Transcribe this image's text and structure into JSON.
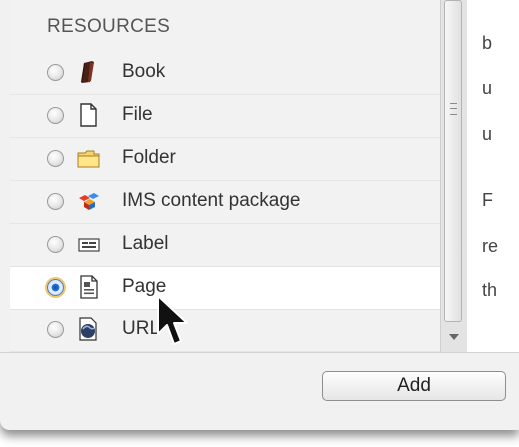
{
  "resources": {
    "heading": "RESOURCES",
    "items": [
      {
        "label": "Book",
        "icon": "book-icon",
        "selected": false
      },
      {
        "label": "File",
        "icon": "file-icon",
        "selected": false
      },
      {
        "label": "Folder",
        "icon": "folder-icon",
        "selected": false
      },
      {
        "label": "IMS content package",
        "icon": "ims-package-icon",
        "selected": false
      },
      {
        "label": "Label",
        "icon": "label-icon",
        "selected": false
      },
      {
        "label": "Page",
        "icon": "page-icon",
        "selected": true
      },
      {
        "label": "URL",
        "icon": "url-icon",
        "selected": false
      }
    ]
  },
  "description": {
    "fragments": [
      "b",
      "u",
      "u",
      "F",
      "re",
      "th"
    ]
  },
  "footer": {
    "add_label": "Add"
  },
  "colors": {
    "selected_radio_ring": "#f0c775",
    "selected_radio_dot": "#2a78d8",
    "panel_bg": "#f2f2f2"
  }
}
